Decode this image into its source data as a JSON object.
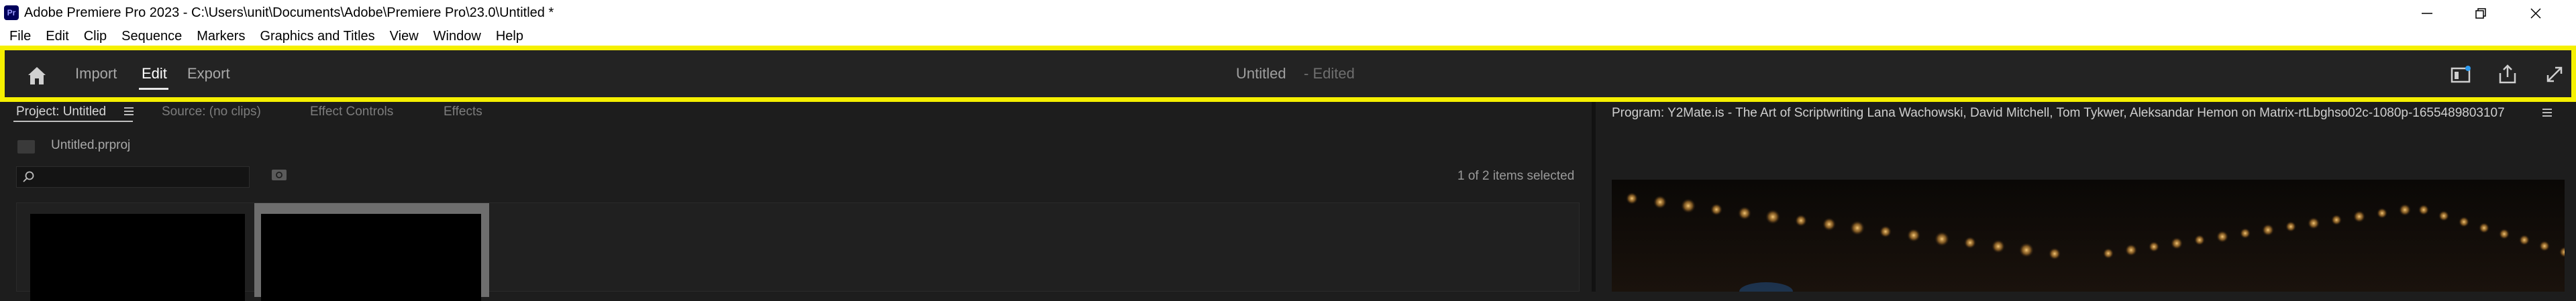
{
  "window": {
    "app_icon": "Pr",
    "title": "Adobe Premiere Pro 2023 - C:\\Users\\unit\\Documents\\Adobe\\Premiere Pro\\23.0\\Untitled *"
  },
  "menu": {
    "items": [
      "File",
      "Edit",
      "Clip",
      "Sequence",
      "Markers",
      "Graphics and Titles",
      "View",
      "Window",
      "Help"
    ]
  },
  "header": {
    "nav": {
      "import": "Import",
      "edit": "Edit",
      "export": "Export"
    },
    "active_tab": "Edit",
    "doc_title": "Untitled",
    "doc_status": "- Edited",
    "icons": [
      "home-icon",
      "quick-panel-icon",
      "share-icon",
      "fullscreen-icon"
    ],
    "highlight_color": "#f5f000"
  },
  "left_panel": {
    "tabs": {
      "project": "Project: Untitled",
      "source": "Source: (no clips)",
      "effect_controls": "Effect Controls",
      "effects": "Effects"
    },
    "project_file": "Untitled.prproj",
    "search": {
      "value": "",
      "placeholder": ""
    },
    "selection_count": "1 of 2 items selected"
  },
  "right_panel": {
    "program_title": "Program: Y2Mate.is - The Art of Scriptwriting Lana Wachowski, David Mitchell, Tom Tykwer, Aleksandar Hemon on Matrix-rtLbghso02c-1080p-1655489803107"
  }
}
